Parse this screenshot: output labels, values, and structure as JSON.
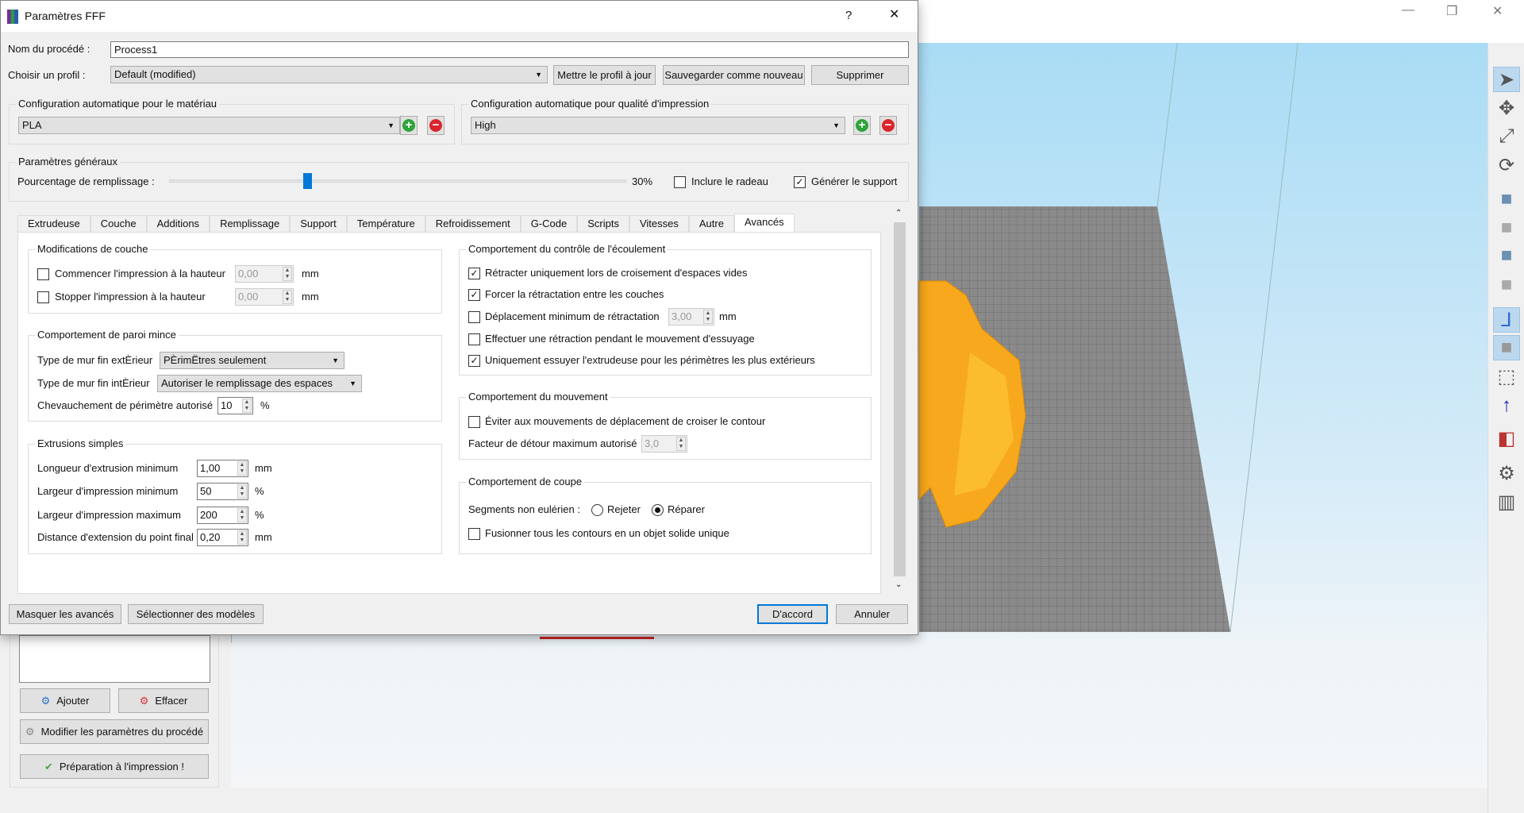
{
  "window": {
    "title": "Paramètres FFF",
    "help": "?",
    "close": "✕"
  },
  "app": {
    "minimize": "—",
    "restore": "❐",
    "close": "✕"
  },
  "process": {
    "label": "Nom du procédé :",
    "value": "Process1"
  },
  "profile": {
    "label": "Choisir un profil :",
    "value": "Default (modified)",
    "update": "Mettre le profil à jour",
    "save_new": "Sauvegarder comme nouveau",
    "delete": "Supprimer"
  },
  "material": {
    "title": "Configuration automatique pour le matériau",
    "value": "PLA"
  },
  "quality": {
    "title": "Configuration automatique pour qualité d'impression",
    "value": "High"
  },
  "general": {
    "title": "Paramètres généraux",
    "infill_label": "Pourcentage de remplissage :",
    "infill_value": "30%",
    "infill_percent": 30,
    "raft_label": "Inclure le radeau",
    "raft_checked": false,
    "support_label": "Générer le support",
    "support_checked": true
  },
  "tabs": [
    "Extrudeuse",
    "Couche",
    "Additions",
    "Remplissage",
    "Support",
    "Température",
    "Refroidissement",
    "G-Code",
    "Scripts",
    "Vitesses",
    "Autre",
    "Avancés"
  ],
  "active_tab": "Avancés",
  "layer_mod": {
    "title": "Modifications de couche",
    "start_label": "Commencer l'impression à la hauteur",
    "start_value": "0,00",
    "stop_label": "Stopper  l'impression à la hauteur",
    "stop_value": "0,00",
    "unit": "mm"
  },
  "thin_wall": {
    "title": "Comportement de paroi mince",
    "outer_label": "Type de mur fin extÈrieur",
    "outer_value": "PÈrimËtres seulement",
    "inner_label": "Type de mur fin intÈrieur",
    "inner_value": "Autoriser le remplissage des espaces",
    "overlap_label": "Chevauchement de périmètre autorisé",
    "overlap_value": "10",
    "overlap_unit": "%"
  },
  "single_ext": {
    "title": "Extrusions simples",
    "rows": [
      {
        "label": "Longueur d'extrusion minimum",
        "value": "1,00",
        "unit": "mm"
      },
      {
        "label": "Largeur d'impression minimum",
        "value": "50",
        "unit": "%"
      },
      {
        "label": "Largeur d'impression maximum",
        "value": "200",
        "unit": "%"
      },
      {
        "label": "Distance d'extension du point final",
        "value": "0,20",
        "unit": "mm"
      }
    ]
  },
  "flow": {
    "title": "Comportement du contrôle de l'écoulement",
    "rows": [
      {
        "label": "Rétracter uniquement lors de croisement d'espaces vides",
        "checked": true
      },
      {
        "label": "Forcer la rétractation entre les couches",
        "checked": true
      },
      {
        "label": "Déplacement minimum de rétractation",
        "checked": false
      },
      {
        "label": "Effectuer une rétraction pendant le mouvement d'essuyage",
        "checked": false
      },
      {
        "label": "Uniquement essuyer l'extrudeuse pour les périmètres les plus extérieurs",
        "checked": true
      }
    ],
    "min_travel_value": "3,00",
    "min_travel_unit": "mm"
  },
  "movement": {
    "title": "Comportement du mouvement",
    "avoid_label": "Éviter aux mouvements de déplacement de croiser le contour",
    "avoid_checked": false,
    "detour_label": "Facteur de détour maximum autorisé",
    "detour_value": "3,0"
  },
  "slicing": {
    "title": "Comportement de coupe",
    "non_euler_label": "Segments non eulérien :",
    "reject": "Rejeter",
    "repair": "Réparer",
    "selected": "Réparer",
    "merge_label": "Fusionner tous les contours en un objet solide unique",
    "merge_checked": false
  },
  "footer": {
    "hide_advanced": "Masquer les avancés",
    "select_models": "Sélectionner des modèles",
    "ok": "D'accord",
    "cancel": "Annuler"
  },
  "left_panel": {
    "add": "Ajouter",
    "erase": "Effacer",
    "modify": "Modifier les paramètres du procédé",
    "prepare": "Préparation à l'impression !"
  },
  "toolbar": [
    "select-arrow-icon",
    "move-icon",
    "scale-icon",
    "rotate-icon",
    "cube-front-icon",
    "cube-top-icon",
    "cube-side-icon",
    "cube-iso-icon",
    "axes-icon",
    "solid-view-icon",
    "wireframe-icon",
    "normal-arrow-icon",
    "section-cut-icon",
    "gear-icon",
    "supports-icon"
  ],
  "toolbar_active": [
    "select-arrow-icon",
    "axes-icon",
    "solid-view-icon"
  ]
}
